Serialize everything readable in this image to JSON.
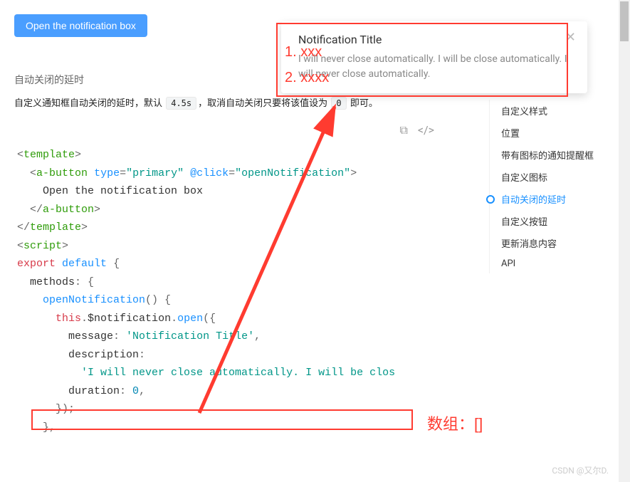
{
  "button": {
    "label": "Open the notification box"
  },
  "section": {
    "title": "自动关闭的延时",
    "desc_pre": "自定义通知框自动关闭的延时，默认 ",
    "desc_code1": "4.5s",
    "desc_mid": "，取消自动关闭只要将该值设为 ",
    "desc_code2": "0",
    "desc_post": " 即可。"
  },
  "code": {
    "template": "template",
    "abutton": "a-button",
    "type_attr": "type",
    "primary": "\"primary\"",
    "click_attr": "@click",
    "openNotif": "\"openNotification\"",
    "buttonText": "Open the notification box",
    "script": "script",
    "export": "export",
    "default": "default",
    "methods": "methods",
    "openNotification": "openNotification",
    "this": "this",
    "notif": "$notification",
    "open": "open",
    "message": "message",
    "messageVal": "'Notification Title'",
    "description": "description",
    "descVal": "'I will never close automatically. I will be clos",
    "duration": "duration",
    "durationVal": "0"
  },
  "sidebar": {
    "items": [
      {
        "label": "自定义样式",
        "active": false
      },
      {
        "label": "位置",
        "active": false
      },
      {
        "label": "带有图标的通知提醒框",
        "active": false
      },
      {
        "label": "自定义图标",
        "active": false
      },
      {
        "label": "自动关闭的延时",
        "active": true
      },
      {
        "label": "自定义按钮",
        "active": false
      },
      {
        "label": "更新消息内容",
        "active": false
      },
      {
        "label": "API",
        "active": false
      }
    ]
  },
  "notification": {
    "title": "Notification Title",
    "desc": "I will never close automatically. I will be close automatically. I will never close automatically."
  },
  "overlay": {
    "line1": "1. xxx",
    "line2": "2. xxxx",
    "arrayLabel": "数组：[]"
  },
  "watermark": "CSDN @又尔D."
}
